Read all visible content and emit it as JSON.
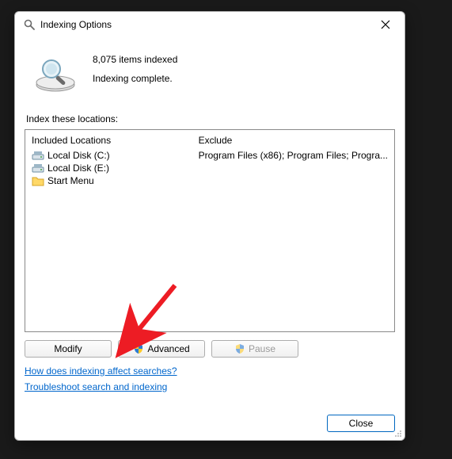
{
  "window": {
    "title": "Indexing Options"
  },
  "status": {
    "count_text": "8,075 items indexed",
    "state_text": "Indexing complete."
  },
  "section_label": "Index these locations:",
  "columns": {
    "included": "Included Locations",
    "exclude": "Exclude"
  },
  "locations": [
    {
      "label": "Local Disk (C:)",
      "icon": "drive",
      "exclude": "Program Files (x86); Program Files; Progra..."
    },
    {
      "label": "Local Disk (E:)",
      "icon": "drive",
      "exclude": ""
    },
    {
      "label": "Start Menu",
      "icon": "folder",
      "exclude": ""
    }
  ],
  "buttons": {
    "modify": "Modify",
    "advanced": "Advanced",
    "pause": "Pause",
    "close": "Close"
  },
  "links": {
    "how": "How does indexing affect searches?",
    "troubleshoot": "Troubleshoot search and indexing"
  },
  "colors": {
    "link": "#0066cc",
    "primary_border": "#0067c0",
    "arrow": "#ed1c24"
  }
}
